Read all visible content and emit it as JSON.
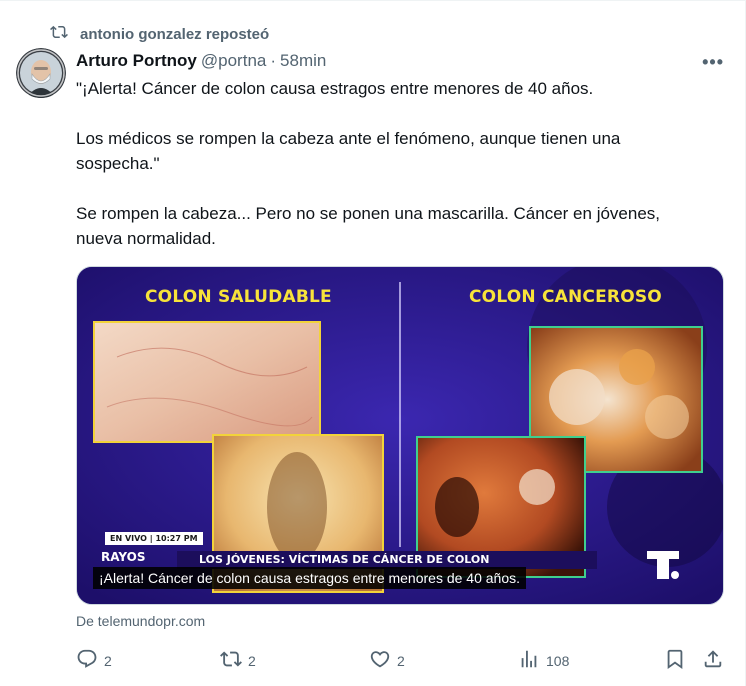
{
  "repost": {
    "text": "antonio gonzalez reposteó",
    "icon": "repost-icon"
  },
  "author": {
    "name": "Arturo Portnoy",
    "handle": "@portna",
    "separator": "·",
    "time": "58min"
  },
  "more_label": "•••",
  "tweet": {
    "line1": "\"¡Alerta! Cáncer de colon causa estragos entre menores de 40 años.",
    "line2": "Los médicos se rompen la cabeza ante el fenómeno, aunque tienen una",
    "line3": "sospecha.\"",
    "line4": "Se rompen la cabeza... Pero no se ponen una mascarilla.  Cáncer en jóvenes,",
    "line5": "nueva normalidad."
  },
  "media": {
    "title_left": "COLON SALUDABLE",
    "title_right": "COLON CANCEROSO",
    "live_badge": "EN VIVO | 10:27 PM",
    "show_name": "RAYOS",
    "lower_third": "LOS JÓVENES: VÍCTIMAS DE CÁNCER DE COLON",
    "caption": "¡Alerta! Cáncer de colon causa estragos entre menores de 40 años.",
    "colors": {
      "background": "#2a1a8e",
      "title_yellow": "#f7e33a",
      "frame_yellow": "#f2d33a",
      "frame_green": "#3fcf8e"
    }
  },
  "source": "De telemundopr.com",
  "actions": {
    "replies": "2",
    "reposts": "2",
    "likes": "2",
    "views": "108"
  }
}
